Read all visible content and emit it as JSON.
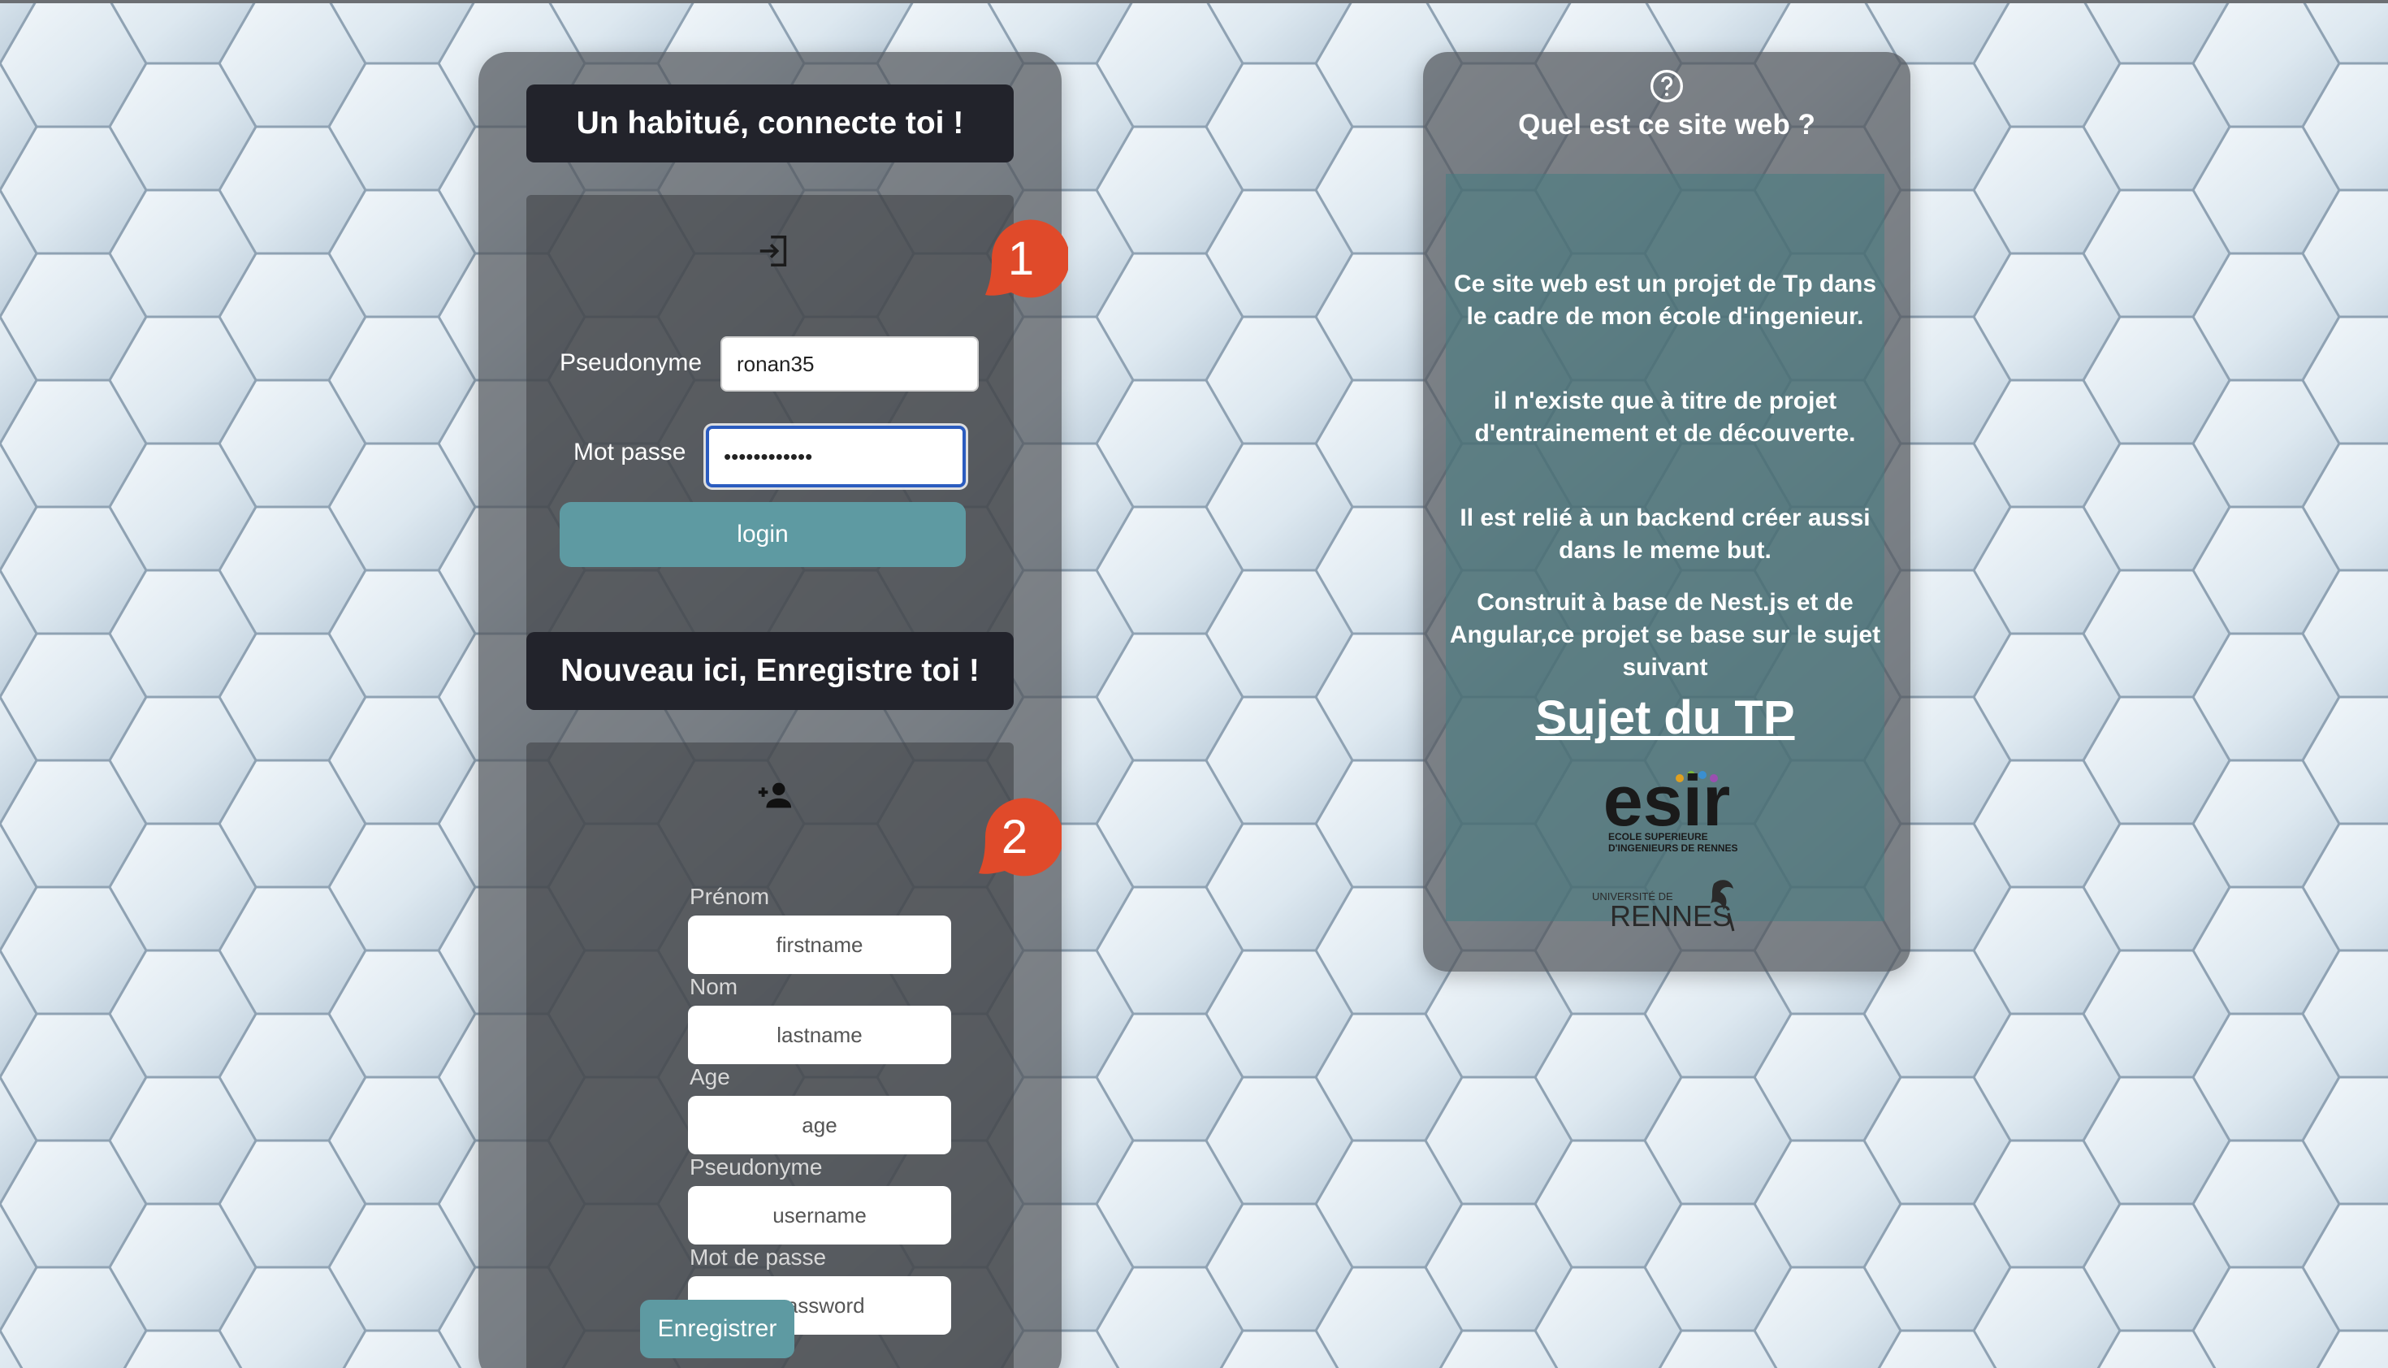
{
  "login": {
    "title": "Un habitué, connecte toi !",
    "icon": "login-icon",
    "username_label": "Pseudonyme",
    "username_value": "ronan35",
    "password_label": "Mot passe",
    "password_value": "••••••••••••",
    "submit_label": "login",
    "badge": "1"
  },
  "register": {
    "title": "Nouveau ici, Enregistre toi !",
    "icon": "person-add-icon",
    "badge": "2",
    "fields": [
      {
        "label": "Prénom",
        "placeholder": "firstname"
      },
      {
        "label": "Nom",
        "placeholder": "lastname"
      },
      {
        "label": "Age",
        "placeholder": "age"
      },
      {
        "label": "Pseudonyme",
        "placeholder": "username"
      },
      {
        "label": "Mot de passe",
        "placeholder": "password"
      }
    ],
    "submit_label": "Enregistrer"
  },
  "about": {
    "icon": "help-circle-icon",
    "title": "Quel est ce site web ?",
    "paragraphs": [
      "Ce site web est un projet de Tp dans le cadre de mon école d'ingenieur.",
      "il n'existe que à titre de projet d'entrainement et de découverte.",
      "Il est relié à un backend créer aussi dans le meme but.",
      "Construit à base de Nest.js et de Angular,ce projet se base sur le sujet suivant"
    ],
    "link_label": "Sujet du TP",
    "logo_esir_text": "esir",
    "logo_esir_sub1": "ECOLE SUPERIEURE",
    "logo_esir_sub2": "D'INGENIEURS DE RENNES",
    "logo_rennes_small": "UNIVERSITÉ DE",
    "logo_rennes_text": "RENNES"
  },
  "colors": {
    "accent": "#5e9aa2",
    "badge": "#e04a2a",
    "title_bg": "#22232b"
  }
}
